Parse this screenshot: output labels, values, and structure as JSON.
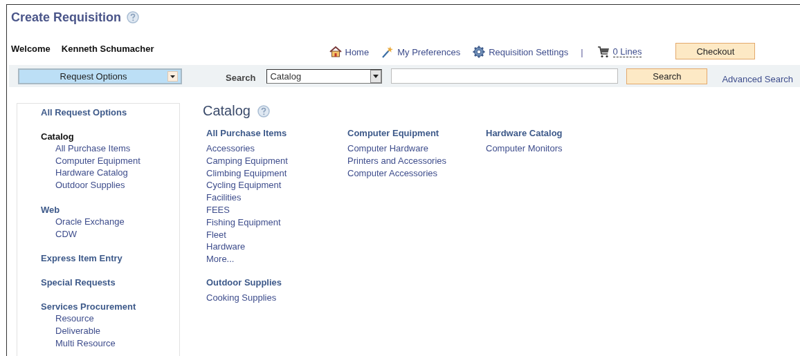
{
  "page": {
    "title": "Create Requisition"
  },
  "welcome": {
    "label": "Welcome",
    "user": "Kenneth Schumacher"
  },
  "nav_links": [
    {
      "kind": "home",
      "label": "Home"
    },
    {
      "kind": "preferences",
      "label": "My Preferences"
    },
    {
      "kind": "settings",
      "label": "Requisition Settings"
    },
    {
      "kind": "separator",
      "label": "|"
    },
    {
      "kind": "cart",
      "label": "0 Lines"
    }
  ],
  "checkout_button": "Checkout",
  "toolbar": {
    "request_options": "Request Options",
    "search_label": "Search",
    "search_type": "Catalog",
    "search_button": "Search",
    "advanced_search": "Advanced Search"
  },
  "sidebar": [
    {
      "label": "All Request Options",
      "selected": false
    },
    {
      "label": "Catalog",
      "selected": true,
      "children": [
        "All Purchase Items",
        "Computer Equipment",
        "Hardware Catalog",
        "Outdoor Supplies"
      ]
    },
    {
      "label": "Web",
      "selected": false,
      "children": [
        "Oracle Exchange",
        "CDW"
      ]
    },
    {
      "label": "Express Item Entry",
      "selected": false
    },
    {
      "label": "Special Requests",
      "selected": false
    },
    {
      "label": "Services Procurement",
      "selected": false,
      "children": [
        "Resource",
        "Deliverable",
        "Multi Resource"
      ]
    }
  ],
  "catalog": {
    "title": "Catalog",
    "sections": [
      {
        "title": "All Purchase Items",
        "items": [
          "Accessories",
          "Camping Equipment",
          "Climbing Equipment",
          "Cycling Equipment",
          "Facilities",
          "FEES",
          "Fishing Equipment",
          "Fleet",
          "Hardware",
          "More..."
        ]
      },
      {
        "title": "Computer Equipment",
        "items": [
          "Computer Hardware",
          "Printers and Accessories",
          "Computer Accessories"
        ]
      },
      {
        "title": "Hardware Catalog",
        "items": [
          "Computer Monitors"
        ]
      },
      {
        "title": "Outdoor Supplies",
        "items": [
          "Cooking Supplies"
        ]
      }
    ]
  }
}
